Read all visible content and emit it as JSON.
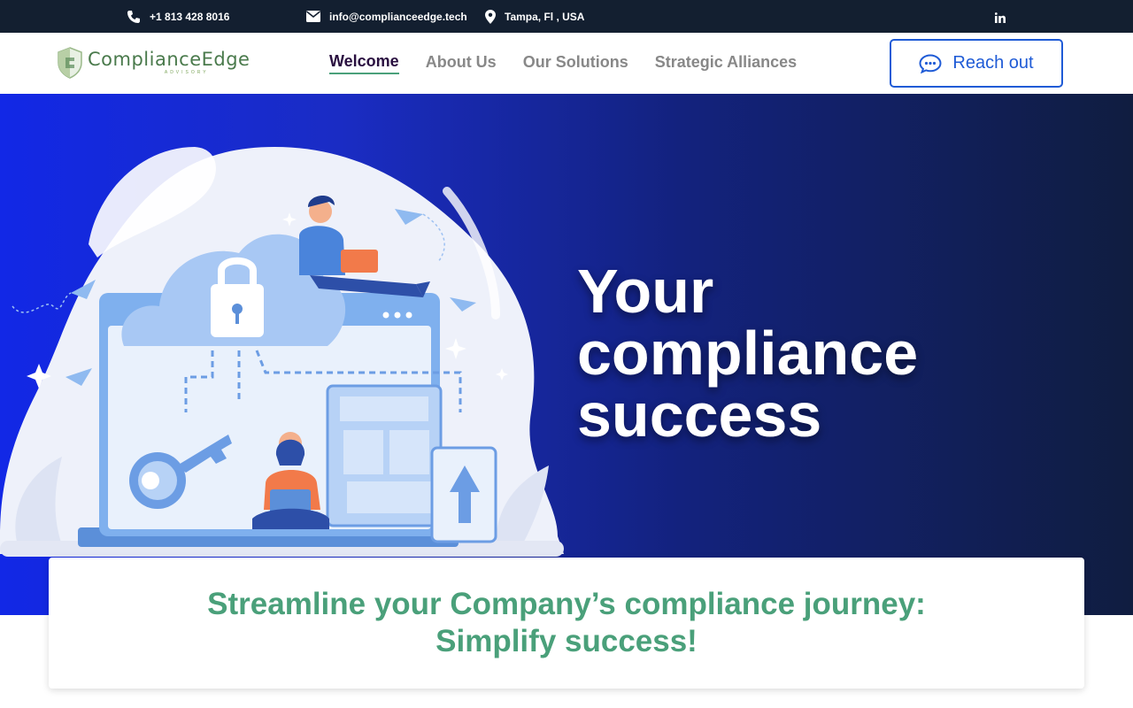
{
  "topbar": {
    "phone": "+1 813 428 8016",
    "email": "info@complianceedge.tech",
    "location": "Tampa, Fl , USA",
    "social_icon": "linkedin-icon"
  },
  "header": {
    "logo": {
      "name": "ComplianceEdge",
      "sub": "ADVISORY"
    },
    "nav": [
      {
        "label": "Welcome",
        "active": true
      },
      {
        "label": "About Us",
        "active": false
      },
      {
        "label": "Our Solutions",
        "active": false
      },
      {
        "label": "Strategic Alliances",
        "active": false
      }
    ],
    "cta": {
      "label": "Reach out",
      "icon": "chat-bubble-icon"
    }
  },
  "hero": {
    "title_lines": [
      "Your",
      "compliance",
      "success"
    ]
  },
  "card": {
    "line1": "Streamline your Company’s compliance journey:",
    "line2": "Simplify success!"
  },
  "colors": {
    "topbar_bg": "#131f30",
    "brand_green": "#4aa07a",
    "cta_blue": "#1f5bd6",
    "hero_start": "#1228e6",
    "hero_end": "#101d40"
  }
}
